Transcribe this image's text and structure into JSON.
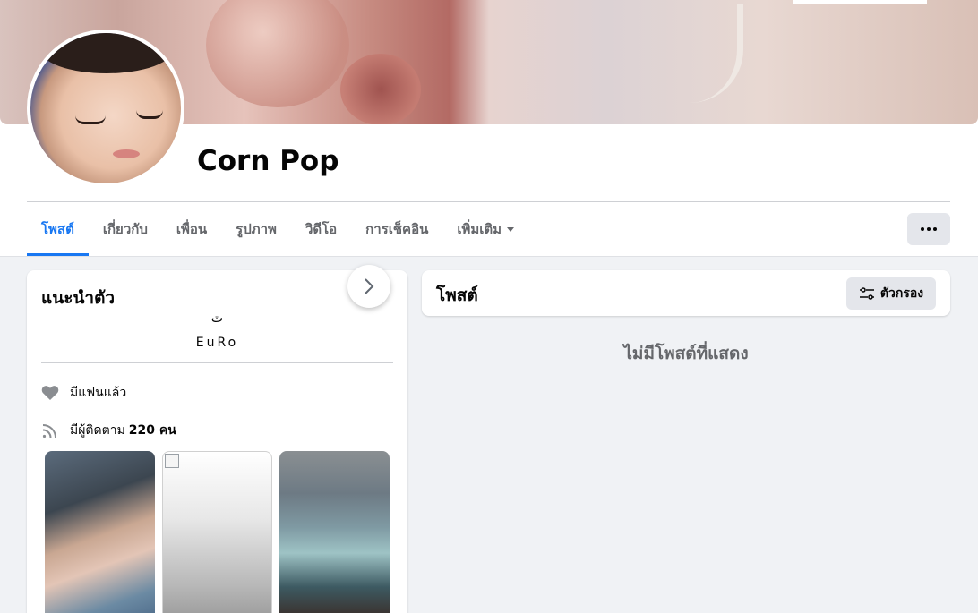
{
  "profile": {
    "name": "Corn Pop"
  },
  "tabs": [
    {
      "label": "โพสต์"
    },
    {
      "label": "เกี่ยวกับ"
    },
    {
      "label": "เพื่อน"
    },
    {
      "label": "รูปภาพ"
    },
    {
      "label": "วิดีโอ"
    },
    {
      "label": "การเช็คอิน"
    },
    {
      "label": "เพิ่มเติม"
    }
  ],
  "intro": {
    "title": "แนะนำตัว",
    "bio_glyph": "ٽ",
    "bio": "EuRo",
    "relationship": "มีแฟนแล้ว",
    "followers_prefix": "มีผู้ติดตาม",
    "followers_count": "220 คน"
  },
  "posts": {
    "title": "โพสต์",
    "filter_label": "ตัวกรอง",
    "empty_text": "ไม่มีโพสต์ที่แสดง"
  },
  "colors": {
    "accent": "#1877f2",
    "secondary_text": "#65676b",
    "button_bg": "#e4e6eb",
    "page_bg": "#f0f2f5"
  }
}
